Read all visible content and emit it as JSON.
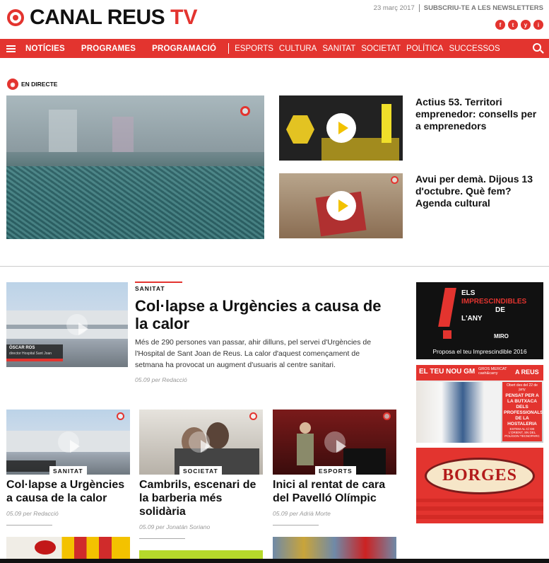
{
  "header": {
    "logo_text": "CANAL REUS",
    "logo_tv": "TV",
    "date": "23 març 2017",
    "subscribe": "SUBSCRIU-TE A LES NEWSLETTERS",
    "socials": [
      "f",
      "t",
      "y",
      "i"
    ]
  },
  "nav": {
    "main": [
      "NOTÍCIES",
      "PROGRAMES",
      "PROGRAMACIÓ"
    ],
    "sections": [
      "ESPORTS",
      "CULTURA",
      "SANITAT",
      "SOCIETAT",
      "POLÍTICA",
      "SUCCESSOS"
    ]
  },
  "live": {
    "label": "EN DIRECTE"
  },
  "side_videos": [
    {
      "title": "Actius 53. Territori emprenedor: consells per a emprenedors"
    },
    {
      "title": "Avui per demà. Dijous 13 d'octubre. Què fem? Agenda cultural"
    }
  ],
  "lead": {
    "tag": "SANITAT",
    "title": "Col·lapse a Urgències a causa de la calor",
    "body": "Més de 290 persones van passar, ahir dilluns, pel servei d'Urgències de l'Hospital de Sant Joan de Reus. La calor d'aquest començament de setmana ha provocat un augment d'usuaris al centre sanitari.",
    "meta": "05.09 per Redacció",
    "caption_name": "ÒSCAR ROS",
    "caption_role": "director Hospital Sant Joan"
  },
  "cards": [
    {
      "tag": "SANITAT",
      "title": "Col·lapse a Urgències a causa de la calor",
      "meta": "05.09 per Redacció"
    },
    {
      "tag": "SOCIETAT",
      "title": "Cambrils, escenari de la barberia més solidària",
      "meta": "05.09 per Jonatán Soriano"
    },
    {
      "tag": "ESPORTS",
      "title": "Inici al rentat de cara del Pavelló Olímpic",
      "meta": "05.09 per Adrià Morte"
    }
  ],
  "ads": {
    "imprescindibles": {
      "line1": "ELS",
      "line2": "IMPRESCINDIBLES",
      "line3": "DE",
      "line4": "L'ANY",
      "brand": "MIRO",
      "cta": "Proposa el teu Imprescindible 2016"
    },
    "gm": {
      "top": "EL TEU NOU GM",
      "store": "GROS MERCAT cash&carry",
      "city": "A REUS",
      "open": "Obert des del 22 de juny",
      "slogan": "PENSAT PER A LA BUTXACA DELS PROFESSIONALS DE LA HOSTALERIA",
      "addr": "ESTEM AL C/ DE L'ORIENT, SN DEL POLÍGON TECNOPARC"
    },
    "borges": {
      "brand": "BORGES"
    }
  },
  "colors": {
    "accent": "#e3342f"
  }
}
